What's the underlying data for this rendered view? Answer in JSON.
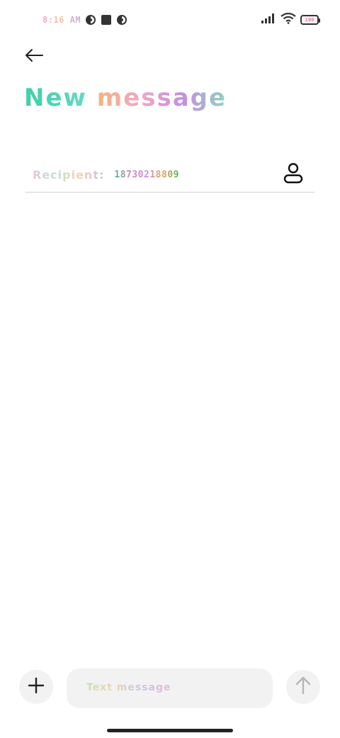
{
  "status_bar": {
    "time": "8:16 AM",
    "battery": "100",
    "icons": [
      "notification-icon",
      "stop-icon",
      "notification-icon",
      "signal-icon",
      "wifi-icon",
      "battery-icon"
    ]
  },
  "header": {
    "back_icon": "arrow-left-icon",
    "title_part_1": "New",
    "title_part_2": "message"
  },
  "recipient": {
    "label": "Recipient:",
    "number": "18730218809",
    "contact_icon": "person-icon"
  },
  "composer": {
    "add_icon": "plus-icon",
    "placeholder": "Text message",
    "send_icon": "arrow-up-icon"
  },
  "colors": {
    "background": "#ffffff",
    "composer_bg": "#f2f2f2",
    "divider": "#e6e6e6",
    "icon_dark": "#222222",
    "send_disabled": "#b5b5b5"
  }
}
